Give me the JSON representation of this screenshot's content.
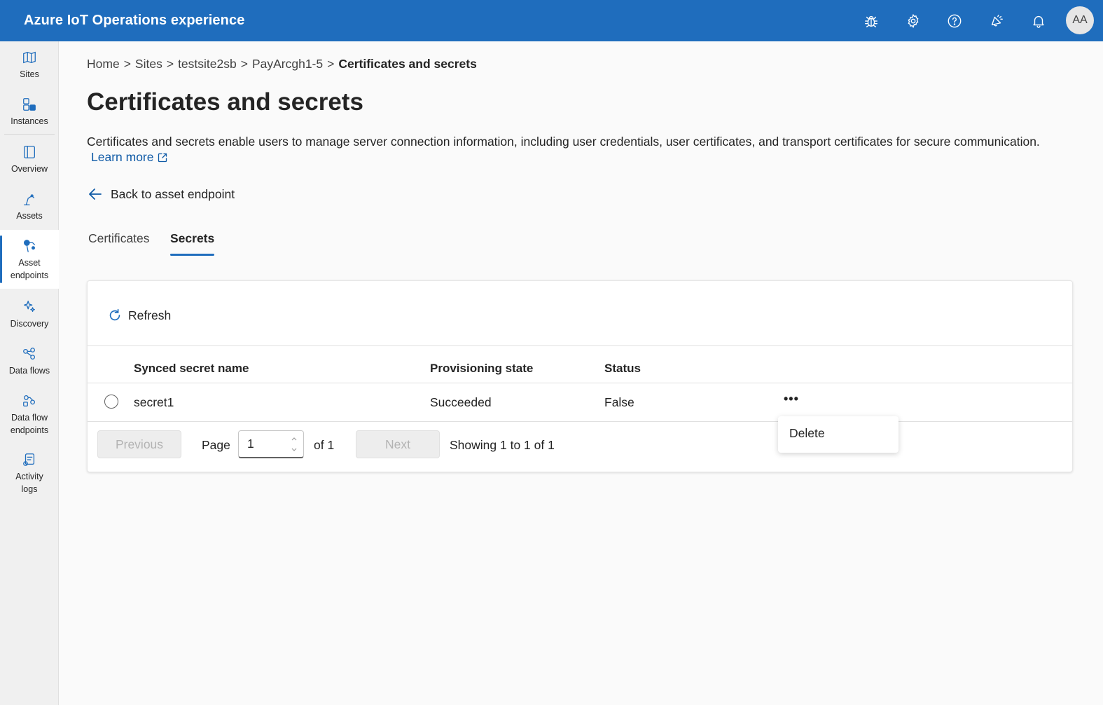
{
  "header": {
    "title": "Azure IoT Operations experience",
    "avatar_initials": "AA",
    "color": "#1f6dbd",
    "icons": [
      "bug-icon",
      "gear-icon",
      "help-icon",
      "announcement-icon",
      "bell-icon"
    ]
  },
  "sidebar": {
    "items": [
      {
        "label": "Sites",
        "icon": "sites-icon"
      },
      {
        "label": "Instances",
        "icon": "instances-icon"
      },
      {
        "label": "Overview",
        "icon": "overview-icon"
      },
      {
        "label": "Assets",
        "icon": "assets-icon"
      },
      {
        "label": "Asset endpoints",
        "icon": "asset-endpoints-icon",
        "active": true
      },
      {
        "label": "Discovery",
        "icon": "discovery-icon"
      },
      {
        "label": "Data flows",
        "icon": "data-flows-icon"
      },
      {
        "label": "Data flow endpoints",
        "icon": "data-flow-endpoints-icon"
      },
      {
        "label": "Activity logs",
        "icon": "activity-logs-icon"
      }
    ]
  },
  "breadcrumb": {
    "items": [
      "Home",
      "Sites",
      "testsite2sb",
      "PayArcgh1-5"
    ],
    "separator": ">",
    "current": "Certificates and secrets"
  },
  "page": {
    "title": "Certificates and secrets",
    "description": "Certificates and secrets enable users to manage server connection information, including user credentials, user certificates, and transport certificates for secure communication.",
    "learn_more": "Learn more",
    "back_label": "Back to asset endpoint"
  },
  "tabs": [
    {
      "label": "Certificates",
      "active": false
    },
    {
      "label": "Secrets",
      "active": true
    }
  ],
  "table": {
    "refresh_label": "Refresh",
    "columns": [
      "Synced secret name",
      "Provisioning state",
      "Status"
    ],
    "rows": [
      {
        "name": "secret1",
        "state": "Succeeded",
        "status": "False",
        "actions": "•••"
      }
    ]
  },
  "pagination": {
    "previous_label": "Previous",
    "page_label": "Page",
    "page_value": "1",
    "of_label": "of 1",
    "next_label": "Next",
    "showing": "Showing 1 to 1 of 1"
  },
  "context_menu": {
    "items": [
      "Delete"
    ]
  }
}
